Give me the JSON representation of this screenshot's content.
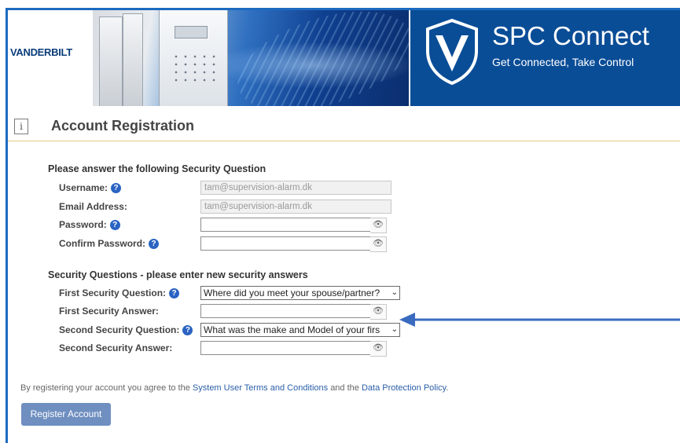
{
  "header": {
    "logo_text": "VANDERBILT",
    "brand_title": "SPC Connect",
    "brand_subtitle": "Get Connected, Take Control"
  },
  "page": {
    "title": "Account Registration",
    "info_icon": "i"
  },
  "account_section": {
    "title": "Please answer the following Security Question",
    "username_label": "Username:",
    "username_value": "tam@supervision-alarm.dk",
    "email_label": "Email Address:",
    "email_value": "tam@supervision-alarm.dk",
    "password_label": "Password:",
    "password_value": "",
    "confirm_password_label": "Confirm Password:",
    "confirm_password_value": ""
  },
  "security_section": {
    "title": "Security Questions - please enter new security answers",
    "q1_label": "First Security Question:",
    "q1_value": "Where did you meet your spouse/partner?",
    "a1_label": "First Security Answer:",
    "a1_value": "",
    "q2_label": "Second Security Question:",
    "q2_value": "What was the make and Model of your firs",
    "a2_label": "Second Security Answer:",
    "a2_value": ""
  },
  "terms": {
    "prefix": "By registering your account you agree to the",
    "link1": "System User Terms and Conditions",
    "middle": "and the",
    "link2": "Data Protection Policy",
    "suffix": "."
  },
  "register_button": "Register Account",
  "help_icon_glyph": "?",
  "eye_icon_glyph": "👁",
  "chevron_glyph": "⌄",
  "colors": {
    "brand_blue": "#0a4d97",
    "button": "#6f8fc0",
    "link": "#2a5ea8",
    "arrow": "#3a6bbf"
  }
}
